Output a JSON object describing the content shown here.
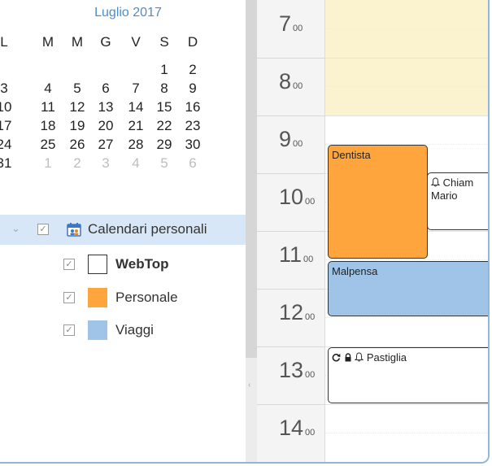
{
  "mini_calendar": {
    "month_title": "Luglio 2017",
    "weekdays": [
      "L",
      "M",
      "M",
      "G",
      "V",
      "S",
      "D"
    ],
    "weeks": [
      [
        {
          "d": "",
          "o": false
        },
        {
          "d": "",
          "o": false
        },
        {
          "d": "",
          "o": false
        },
        {
          "d": "",
          "o": false
        },
        {
          "d": "",
          "o": false
        },
        {
          "d": "1",
          "o": false
        },
        {
          "d": "2",
          "o": false
        }
      ],
      [
        {
          "d": "3",
          "o": false
        },
        {
          "d": "4",
          "o": false
        },
        {
          "d": "5",
          "o": false
        },
        {
          "d": "6",
          "o": false
        },
        {
          "d": "7",
          "o": false
        },
        {
          "d": "8",
          "o": false
        },
        {
          "d": "9",
          "o": false
        }
      ],
      [
        {
          "d": "10",
          "o": false
        },
        {
          "d": "11",
          "o": false
        },
        {
          "d": "12",
          "o": false
        },
        {
          "d": "13",
          "o": false
        },
        {
          "d": "14",
          "o": false
        },
        {
          "d": "15",
          "o": false
        },
        {
          "d": "16",
          "o": false
        }
      ],
      [
        {
          "d": "17",
          "o": false
        },
        {
          "d": "18",
          "o": false
        },
        {
          "d": "19",
          "o": false
        },
        {
          "d": "20",
          "o": false
        },
        {
          "d": "21",
          "o": false
        },
        {
          "d": "22",
          "o": false
        },
        {
          "d": "23",
          "o": false
        }
      ],
      [
        {
          "d": "24",
          "o": false
        },
        {
          "d": "25",
          "o": false
        },
        {
          "d": "26",
          "o": false
        },
        {
          "d": "27",
          "o": false
        },
        {
          "d": "28",
          "o": false
        },
        {
          "d": "29",
          "o": false
        },
        {
          "d": "30",
          "o": false
        }
      ],
      [
        {
          "d": "31",
          "o": false
        },
        {
          "d": "1",
          "o": true
        },
        {
          "d": "2",
          "o": true
        },
        {
          "d": "3",
          "o": true
        },
        {
          "d": "4",
          "o": true
        },
        {
          "d": "5",
          "o": true
        },
        {
          "d": "6",
          "o": true
        }
      ]
    ]
  },
  "tree": {
    "root_label": "Calendari personali",
    "root_icon": "calendar-people-icon",
    "items": [
      {
        "label": "WebTop",
        "color": "#ffffff",
        "bold": true
      },
      {
        "label": "Personale",
        "color": "#ffa53d",
        "bold": false
      },
      {
        "label": "Viaggi",
        "color": "#9fc4e7",
        "bold": false
      }
    ]
  },
  "time_axis": {
    "hours": [
      {
        "h": "7",
        "m": "00"
      },
      {
        "h": "8",
        "m": "00"
      },
      {
        "h": "9",
        "m": "00"
      },
      {
        "h": "10",
        "m": "00"
      },
      {
        "h": "11",
        "m": "00"
      },
      {
        "h": "12",
        "m": "00"
      },
      {
        "h": "13",
        "m": "00"
      },
      {
        "h": "14",
        "m": "00"
      }
    ]
  },
  "events": {
    "dentista": {
      "title": "Dentista",
      "color": "#ffa53d"
    },
    "chiamata": {
      "title_line1": "Chiam",
      "title_line2": "Mario",
      "color": "#ffffff",
      "icons": [
        "bell-icon"
      ]
    },
    "malpensa": {
      "title": "Malpensa",
      "color": "#9fc4e7"
    },
    "pastiglia": {
      "title": "Pastiglia",
      "color": "#ffffff",
      "icons": [
        "recurrence-icon",
        "lock-icon",
        "bell-icon"
      ]
    }
  },
  "colors": {
    "accent": "#4f8cc9",
    "offhours": "#fbf2cf",
    "selection": "#d8e7f7"
  }
}
